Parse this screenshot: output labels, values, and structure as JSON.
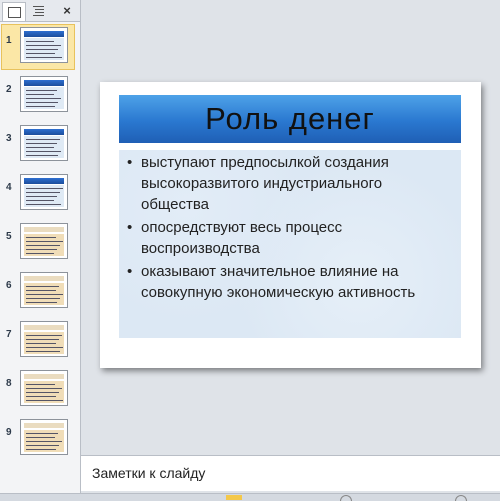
{
  "thumbnail_pane": {
    "close_label": "×",
    "thumbnails": [
      {
        "number": "1",
        "style": "blue",
        "selected": true
      },
      {
        "number": "2",
        "style": "blue",
        "selected": false
      },
      {
        "number": "3",
        "style": "blue",
        "selected": false
      },
      {
        "number": "4",
        "style": "blue",
        "selected": false
      },
      {
        "number": "5",
        "style": "beige",
        "selected": false
      },
      {
        "number": "6",
        "style": "beige",
        "selected": false
      },
      {
        "number": "7",
        "style": "beige",
        "selected": false
      },
      {
        "number": "8",
        "style": "beige",
        "selected": false
      },
      {
        "number": "9",
        "style": "beige",
        "selected": false
      }
    ]
  },
  "slide": {
    "title": "Роль  денег",
    "bullet_symbol": "•",
    "bullets": [
      "выступают предпосылкой  создания высокоразвитого  индустриального общества",
      "опосредствуют весь процесс воспроизводства",
      "оказывают  значительное  влияние  на совокупную экономическую активность"
    ]
  },
  "notes": {
    "placeholder": "Заметки к слайду"
  },
  "colors": {
    "title_bar": "#2a78d0",
    "body_bg": "#dce8f4",
    "selected_thumb": "#fbe7a6"
  }
}
